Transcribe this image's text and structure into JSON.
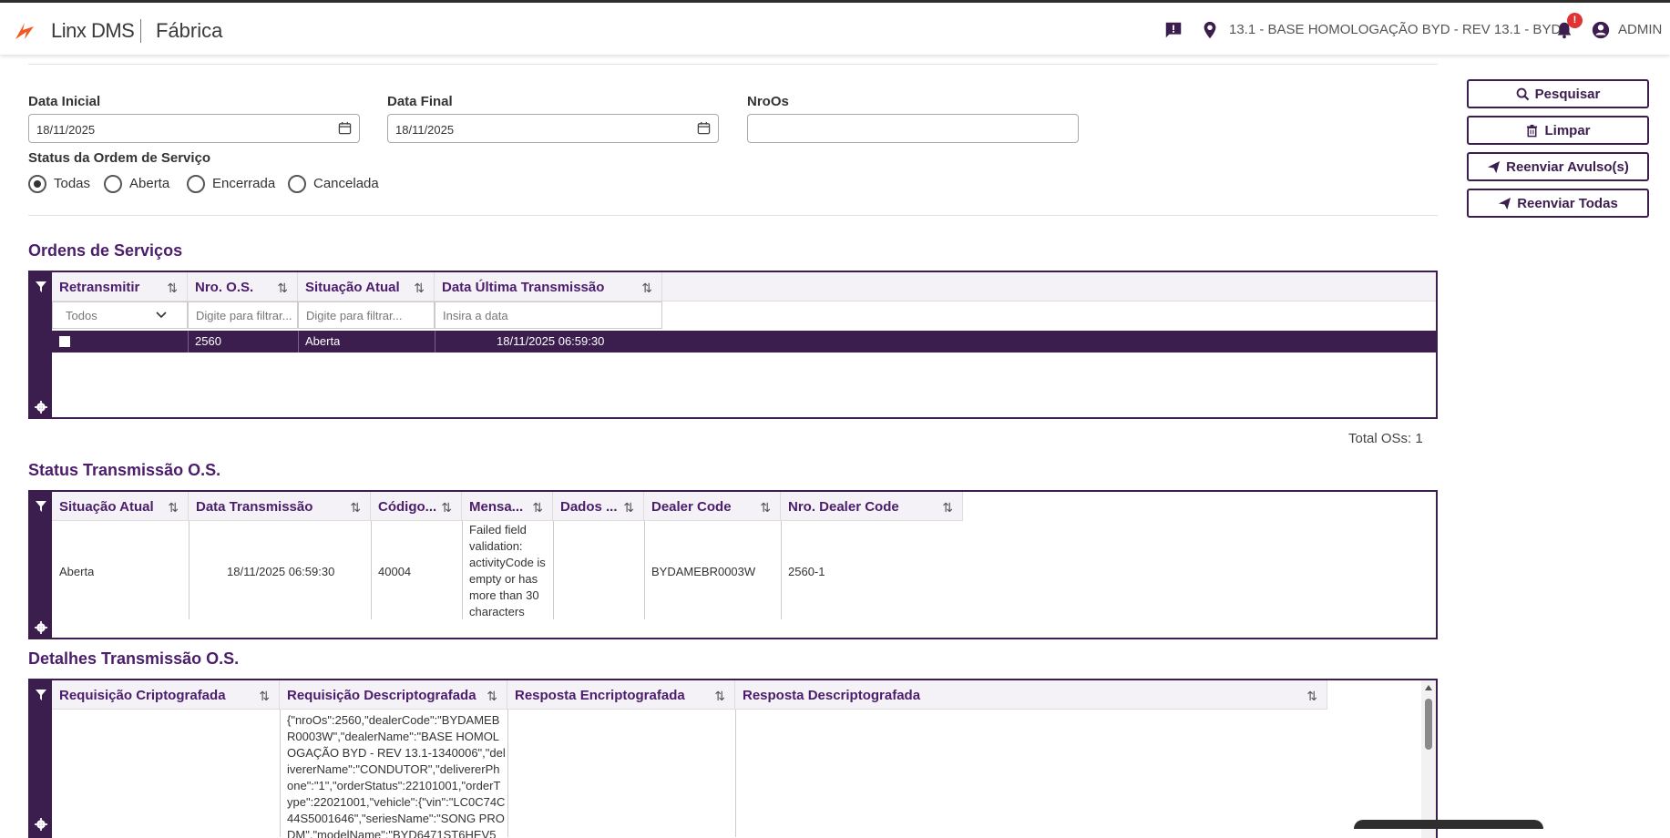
{
  "app": {
    "brand": "Linx DMS",
    "module": "Fábrica",
    "environment": "13.1 - BASE HOMOLOGAÇÃO BYD - REV 13.1 - BYD",
    "user": "ADMIN",
    "notifications_badge": "!",
    "accent": "#3b1d4e",
    "brand_color": "#f05a22"
  },
  "filters": {
    "data_inicial": {
      "label": "Data Inicial",
      "value": "18/11/2025"
    },
    "data_final": {
      "label": "Data Final",
      "value": "18/11/2025"
    },
    "nro_os": {
      "label": "NroOs",
      "value": ""
    },
    "status": {
      "label": "Status da Ordem de Serviço",
      "options": [
        "Todas",
        "Aberta",
        "Encerrada",
        "Cancelada"
      ],
      "selected": "Todas"
    }
  },
  "actions": {
    "pesquisar": "Pesquisar",
    "limpar": "Limpar",
    "reenviar_avulsos": "Reenviar Avulso(s)",
    "reenviar_todas": "Reenviar Todas"
  },
  "ordens": {
    "title": "Ordens de Serviços",
    "columns": [
      "Retransmitir",
      "Nro. O.S.",
      "Situação Atual",
      "Data Última Transmissão"
    ],
    "filter_placeholders": {
      "retransmitir": "Todos",
      "nro_os": "Digite para filtrar...",
      "situacao": "Digite para filtrar...",
      "data": "Insira a data"
    },
    "rows": [
      {
        "nro_os": "2560",
        "situacao": "Aberta",
        "data": "18/11/2025 06:59:30"
      }
    ],
    "total": "Total OSs: 1"
  },
  "status_tx": {
    "title": "Status Transmissão O.S.",
    "columns": [
      "Situação Atual",
      "Data Transmissão",
      "Código...",
      "Mensa...",
      "Dados ...",
      "Dealer Code",
      "Nro. Dealer Code"
    ],
    "rows": [
      {
        "situacao": "Aberta",
        "data": "18/11/2025 06:59:30",
        "codigo": "40004",
        "mensagem": "Failed field validation: activityCode is empty or has more than 30 characters",
        "dados": "",
        "dealer_code": "BYDAMEBR0003W",
        "nro_dealer": "2560-1"
      }
    ]
  },
  "detalhes": {
    "title": "Detalhes Transmissão O.S.",
    "columns": [
      "Requisição Criptografada",
      "Requisição Descriptografada",
      "Resposta Encriptografada",
      "Resposta Descriptografada"
    ],
    "rows": [
      {
        "req_cripto": "",
        "req_descripto": "{\"nroOs\":2560,\"dealerCode\":\"BYDAMEBR0003W\",\"dealerName\":\"BASE HOMOLOGAÇÃO BYD - REV 13.1-1340006\",\"delivererName\":\"CONDUTOR\",\"delivererPhone\":\"1\",\"orderStatus\":22101001,\"orderType\":22021001,\"vehicle\":{\"vin\":\"LC0C74C44S5001646\",\"seriesName\":\"SONG PRO DM\",\"modelName\":\"BYD6471ST6HEV5",
        "resp_encripto": "",
        "resp_descripto": ""
      }
    ]
  }
}
